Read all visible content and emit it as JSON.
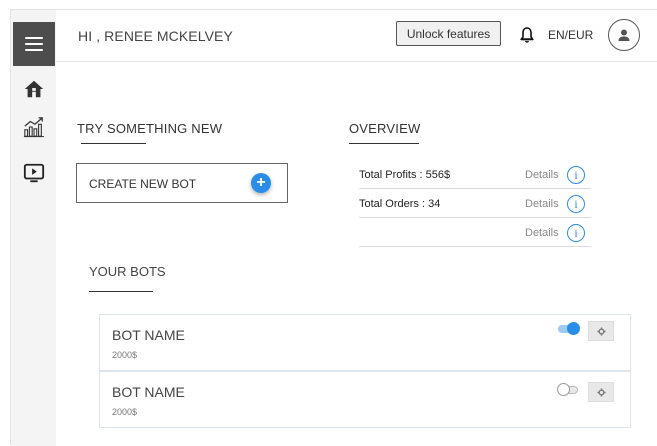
{
  "header": {
    "greeting": "HI , RENEE MCKELVEY",
    "unlock_label": "Unlock features",
    "locale": "EN/EUR"
  },
  "sidebar": {
    "icons": [
      "menu-icon",
      "home-icon",
      "analytics-icon",
      "play-screen-icon"
    ]
  },
  "try_section": {
    "title": "TRY SOMETHING NEW",
    "create_bot_label": "CREATE NEW BOT"
  },
  "overview": {
    "title": "OVERVIEW",
    "rows": [
      {
        "label": "Total Profits : 556$",
        "details": "Details"
      },
      {
        "label": "Total Orders : 34",
        "details": "Details"
      },
      {
        "label": "",
        "details": "Details"
      }
    ]
  },
  "bots": {
    "title": "YOUR BOTS",
    "items": [
      {
        "name": "BOT NAME",
        "amount": "2000$",
        "enabled": true
      },
      {
        "name": "BOT NAME",
        "amount": "2000$",
        "enabled": false
      }
    ]
  },
  "colors": {
    "accent": "#2b8ee6",
    "sidebar_bg": "#f4f4f4",
    "menu_bg": "#4d4d4d"
  }
}
